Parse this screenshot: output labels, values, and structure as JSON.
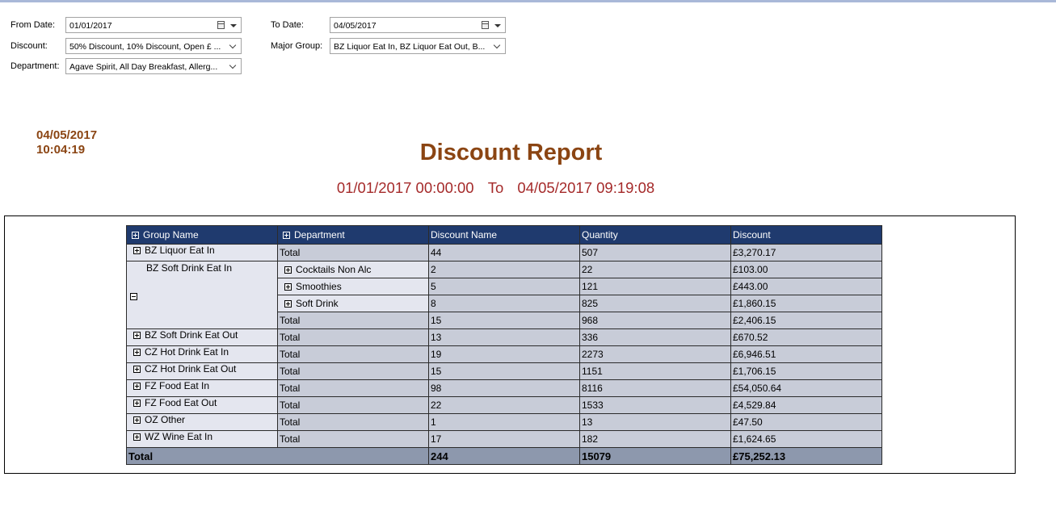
{
  "params": {
    "from_date": {
      "label": "From Date:",
      "value": "01/01/2017"
    },
    "to_date": {
      "label": "To Date:",
      "value": "04/05/2017"
    },
    "discount": {
      "label": "Discount:",
      "value": "50% Discount, 10% Discount, Open £ ..."
    },
    "major_group": {
      "label": "Major Group:",
      "value": "BZ Liquor Eat In, BZ Liquor Eat Out, B..."
    },
    "department": {
      "label": "Department:",
      "value": "Agave Spirit, All Day Breakfast, Allerg..."
    }
  },
  "report": {
    "run_date": "04/05/2017",
    "run_time": "10:04:19",
    "title": "Discount Report",
    "range_from": "01/01/2017 00:00:00",
    "range_to_word": "To",
    "range_to": "04/05/2017 09:19:08"
  },
  "table": {
    "headers": [
      "Group Name",
      "Department",
      "Discount Name",
      "Quantity",
      "Discount"
    ],
    "rows": [
      {
        "group": "BZ Liquor Eat In",
        "dept": "Total",
        "name": "44",
        "qty": "507",
        "disc": "£3,270.17"
      },
      {
        "group": "BZ Soft Drink Eat In",
        "sub": [
          {
            "dept": "Cocktails Non Alc",
            "name": "2",
            "qty": "22",
            "disc": "£103.00"
          },
          {
            "dept": "Smoothies",
            "name": "5",
            "qty": "121",
            "disc": "£443.00"
          },
          {
            "dept": "Soft Drink",
            "name": "8",
            "qty": "825",
            "disc": "£1,860.15"
          },
          {
            "dept": "Total",
            "name": "15",
            "qty": "968",
            "disc": "£2,406.15"
          }
        ]
      },
      {
        "group": "BZ Soft Drink Eat Out",
        "dept": "Total",
        "name": "13",
        "qty": "336",
        "disc": "£670.52"
      },
      {
        "group": "CZ Hot Drink Eat In",
        "dept": "Total",
        "name": "19",
        "qty": "2273",
        "disc": "£6,946.51"
      },
      {
        "group": "CZ Hot Drink Eat Out",
        "dept": "Total",
        "name": "15",
        "qty": "1151",
        "disc": "£1,706.15"
      },
      {
        "group": "FZ Food Eat In",
        "dept": "Total",
        "name": "98",
        "qty": "8116",
        "disc": "£54,050.64"
      },
      {
        "group": "FZ Food Eat Out",
        "dept": "Total",
        "name": "22",
        "qty": "1533",
        "disc": "£4,529.84"
      },
      {
        "group": "OZ Other",
        "dept": "Total",
        "name": "1",
        "qty": "13",
        "disc": "£47.50"
      },
      {
        "group": "WZ Wine Eat In",
        "dept": "Total",
        "name": "17",
        "qty": "182",
        "disc": "£1,624.65"
      }
    ],
    "grand": {
      "label": "Total",
      "name": "244",
      "qty": "15079",
      "disc": "£75,252.13"
    }
  }
}
